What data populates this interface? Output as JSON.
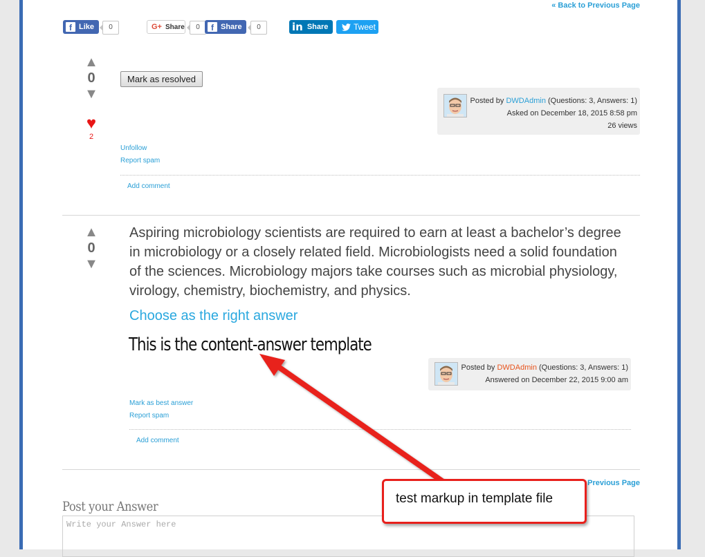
{
  "nav": {
    "back_top": "« Back to Previous Page",
    "back_bottom": "Previous Page"
  },
  "social": {
    "fb_like_label": "Like",
    "fb_like_count": "0",
    "gplus_label": "Share",
    "gplus_count": "0",
    "fb_share_label": "Share",
    "fb_share_count": "0",
    "linkedin_label": "Share",
    "tweet_label": "Tweet"
  },
  "question": {
    "vote_count": "0",
    "favorite_count": "2",
    "mark_resolved_label": "Mark as resolved",
    "posted_by_prefix": "Posted by",
    "author": "DWDAdmin",
    "author_stats": "(Questions: 3, Answers: 1)",
    "asked_on": "Asked on December 18, 2015 8:58 pm",
    "views": "26 views",
    "unfollow": "Unfollow",
    "report_spam": "Report spam",
    "add_comment": "Add comment"
  },
  "answer": {
    "vote_count": "0",
    "body": "Aspiring microbiology scientists are required to earn at least a bachelor’s degree in microbiology or a closely related field. Microbiologists need a solid foundation of the sciences. Microbiology majors take courses such as microbial physiology, virology, chemistry, biochemistry, and physics.",
    "choose_right": "Choose as the right answer",
    "template_note": "This is the content-answer template",
    "posted_by_prefix": "Posted by",
    "author": "DWDAdmin",
    "author_stats": "(Questions: 3, Answers: 1)",
    "answered_on": "Answered on December 22, 2015 9:00 am",
    "mark_best": "Mark as best answer",
    "report_spam": "Report spam",
    "add_comment": "Add comment"
  },
  "post_answer": {
    "title": "Post your Answer",
    "placeholder": "Write your Answer here"
  },
  "callout": {
    "text": "test markup in template file"
  },
  "colors": {
    "accent_blue": "#2a9fd6",
    "frame_blue": "#3a6cb4",
    "callout_red": "#e8201c",
    "heart_red": "#e81616"
  }
}
